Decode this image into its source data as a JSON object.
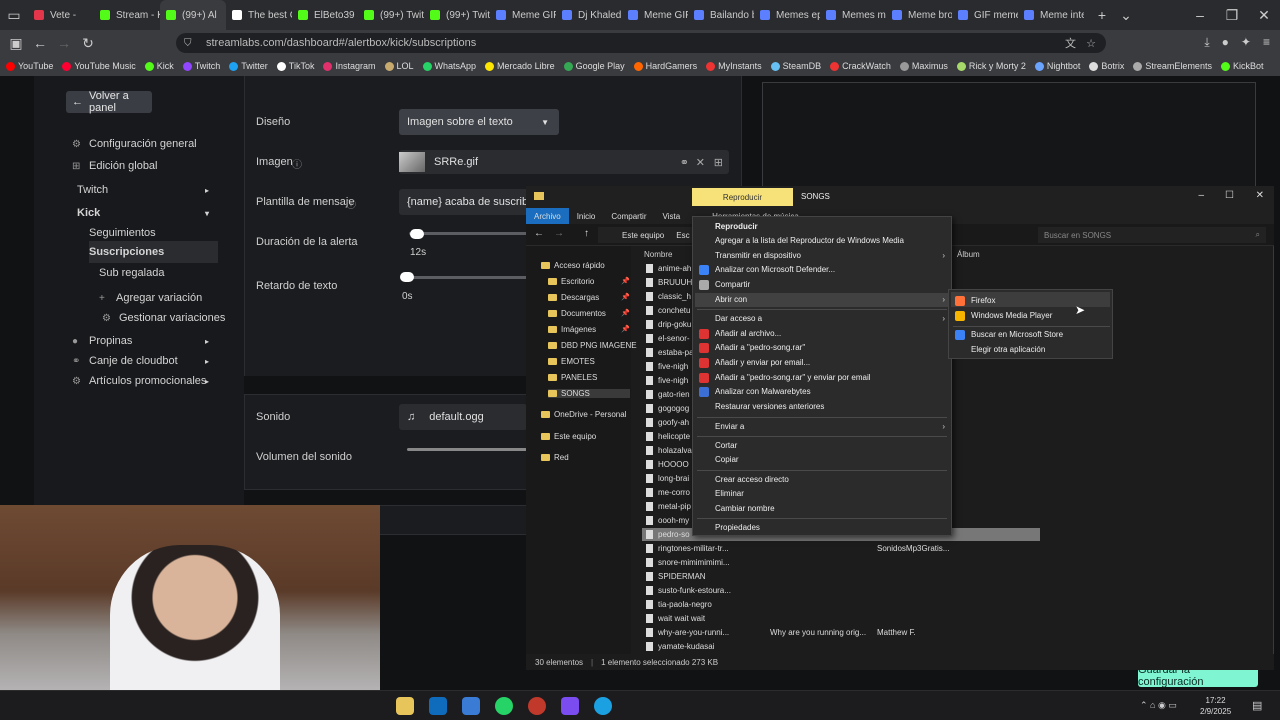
{
  "browser": {
    "tabs": [
      {
        "label": "Vete -",
        "color": "#e3364a"
      },
      {
        "label": "Stream - K",
        "color": "#53fc18"
      },
      {
        "label": "(99+) Al",
        "color": "#53fc18",
        "active": true
      },
      {
        "label": "The best C",
        "color": "#ffffff"
      },
      {
        "label": "ElBeto39 S",
        "color": "#53fc18"
      },
      {
        "label": "(99+) Twit",
        "color": "#53fc18"
      },
      {
        "label": "(99+) Twit",
        "color": "#53fc18"
      },
      {
        "label": "Meme GIF",
        "color": "#5b7fff"
      },
      {
        "label": "Dj Khaled",
        "color": "#5b7fff"
      },
      {
        "label": "Meme GIF",
        "color": "#5b7fff"
      },
      {
        "label": "Bailando b",
        "color": "#5b7fff"
      },
      {
        "label": "Memes ep",
        "color": "#5b7fff"
      },
      {
        "label": "Memes m",
        "color": "#5b7fff"
      },
      {
        "label": "Meme bro",
        "color": "#5b7fff"
      },
      {
        "label": "GIF meme",
        "color": "#5b7fff"
      },
      {
        "label": "Meme inte",
        "color": "#5b7fff"
      }
    ],
    "url": "streamlabs.com/dashboard#/alertbox/kick/subscriptions",
    "bookmarks": [
      {
        "label": "YouTube",
        "color": "#ff0000"
      },
      {
        "label": "YouTube Music",
        "color": "#ff0033"
      },
      {
        "label": "Kick",
        "color": "#53fc18"
      },
      {
        "label": "Twitch",
        "color": "#9146ff"
      },
      {
        "label": "Twitter",
        "color": "#1da1f2"
      },
      {
        "label": "TikTok",
        "color": "#ffffff"
      },
      {
        "label": "Instagram",
        "color": "#e1306c"
      },
      {
        "label": "LOL",
        "color": "#c8aa6e"
      },
      {
        "label": "WhatsApp",
        "color": "#25d366"
      },
      {
        "label": "Mercado Libre",
        "color": "#ffe600"
      },
      {
        "label": "Google Play",
        "color": "#34a853"
      },
      {
        "label": "HardGamers",
        "color": "#ff6600"
      },
      {
        "label": "MyInstants",
        "color": "#e33"
      },
      {
        "label": "SteamDB",
        "color": "#66c0f4"
      },
      {
        "label": "CrackWatch",
        "color": "#e33"
      },
      {
        "label": "Maximus",
        "color": "#999"
      },
      {
        "label": "Rick y Morty 2",
        "color": "#a6d96a"
      },
      {
        "label": "Nightbot",
        "color": "#6ba4ff"
      },
      {
        "label": "Botrix",
        "color": "#ddd"
      },
      {
        "label": "StreamElements",
        "color": "#aaa"
      },
      {
        "label": "KickBot",
        "color": "#53fc18"
      }
    ]
  },
  "sidebar": {
    "back": "Volver a panel",
    "items": [
      "Configuración general",
      "Edición global",
      "Twitch",
      "Kick",
      "Seguimientos",
      "Suscripciones",
      "Sub regalada",
      "Agregar variación",
      "Gestionar variaciones",
      "Propinas",
      "Canje de cloudbot",
      "Artículos promocionales"
    ]
  },
  "form": {
    "design_label": "Diseño",
    "design_value": "Imagen sobre el texto",
    "image_label": "Imagen",
    "image_value": "SRRe.gif",
    "template_label": "Plantilla de mensaje",
    "template_value": "{name} acaba de suscribirse",
    "duration_label": "Duración de la alerta",
    "duration_value": "12s",
    "delay_label": "Retardo de texto",
    "delay_value": "0s",
    "sound_label": "Sonido",
    "sound_value": "default.ogg",
    "volume_label": "Volumen del sonido",
    "save": "Guardar la configuración"
  },
  "explorer": {
    "ribbon_play": "Reproducir",
    "title": "SONGS",
    "tabs": [
      "Archivo",
      "Inicio",
      "Compartir",
      "Vista",
      "Herramientas de música"
    ],
    "path": [
      "Este equipo",
      "Esc"
    ],
    "search_placeholder": "Buscar en SONGS",
    "col_name": "Nombre",
    "col_album": "Álbum",
    "nav": [
      "Acceso rápido",
      "Escritorio",
      "Descargas",
      "Documentos",
      "Imágenes",
      "DBD PNG IMAGENE",
      "EMOTES",
      "PANELES",
      "SONGS",
      "OneDrive - Personal",
      "Este equipo",
      "Red"
    ],
    "files": [
      "anime-ah",
      "BRUUUH",
      "classic_h",
      "conchetu",
      "drip-goku",
      "el-senor-",
      "estaba-pa",
      "five-nigh",
      "five-nigh",
      "gato-rien",
      "gogogog",
      "goofy-ah",
      "helicopte",
      "holazalva",
      "HOOOO",
      "long-brai",
      "me-corro",
      "metal-pip",
      "oooh-my",
      "pedro-so",
      "ringtones-militar-tr...",
      "snore-mimimimimi...",
      "SPIDERMAN",
      "susto-funk-estoura...",
      "tia-paola-negro",
      "wait wait wait",
      "why-are-you-runni...",
      "yamate-kudasai"
    ],
    "extra_cols": [
      {
        "row": 20,
        "album": "SonidosMp3Gratis..."
      },
      {
        "row": 26,
        "title": "Why are you running orig...",
        "album": "Matthew F."
      }
    ],
    "status_count": "30 elementos",
    "status_selected": "1 elemento seleccionado  273 KB"
  },
  "context_menu": {
    "items": [
      {
        "label": "Reproducir",
        "bold": true
      },
      {
        "label": "Agregar a la lista del Reproductor de Windows Media"
      },
      {
        "label": "Transmitir en dispositivo",
        "arrow": true
      },
      {
        "label": "Analizar con Microsoft Defender...",
        "icon": "#3b82f6"
      },
      {
        "label": "Compartir",
        "icon": "#aaa"
      },
      {
        "label": "Abrir con",
        "arrow": true,
        "hl": true
      },
      {
        "label": "Dar acceso a",
        "arrow": true,
        "sep": true
      },
      {
        "label": "Añadir al archivo...",
        "icon": "#d33"
      },
      {
        "label": "Añadir a \"pedro-song.rar\"",
        "icon": "#d33"
      },
      {
        "label": "Añadir y enviar por email...",
        "icon": "#d33"
      },
      {
        "label": "Añadir a \"pedro-song.rar\" y enviar por email",
        "icon": "#d33"
      },
      {
        "label": "Analizar con Malwarebytes",
        "icon": "#3b6fd6"
      },
      {
        "label": "Restaurar versiones anteriores"
      },
      {
        "label": "Enviar a",
        "arrow": true,
        "sep": true
      },
      {
        "label": "Cortar",
        "sep": true
      },
      {
        "label": "Copiar"
      },
      {
        "label": "Crear acceso directo",
        "sep": true
      },
      {
        "label": "Eliminar"
      },
      {
        "label": "Cambiar nombre"
      },
      {
        "label": "Propiedades",
        "sep": true
      }
    ]
  },
  "submenu": {
    "items": [
      {
        "label": "Firefox",
        "icon": "#ff7139"
      },
      {
        "label": "Windows Media Player",
        "icon": "#f7b500"
      },
      {
        "label": "Buscar en Microsoft Store",
        "icon": "#3b82f6",
        "sep": true
      },
      {
        "label": "Elegir otra aplicación"
      }
    ]
  },
  "taskbar": {
    "time": "17:22",
    "date": "2/9/2025"
  }
}
